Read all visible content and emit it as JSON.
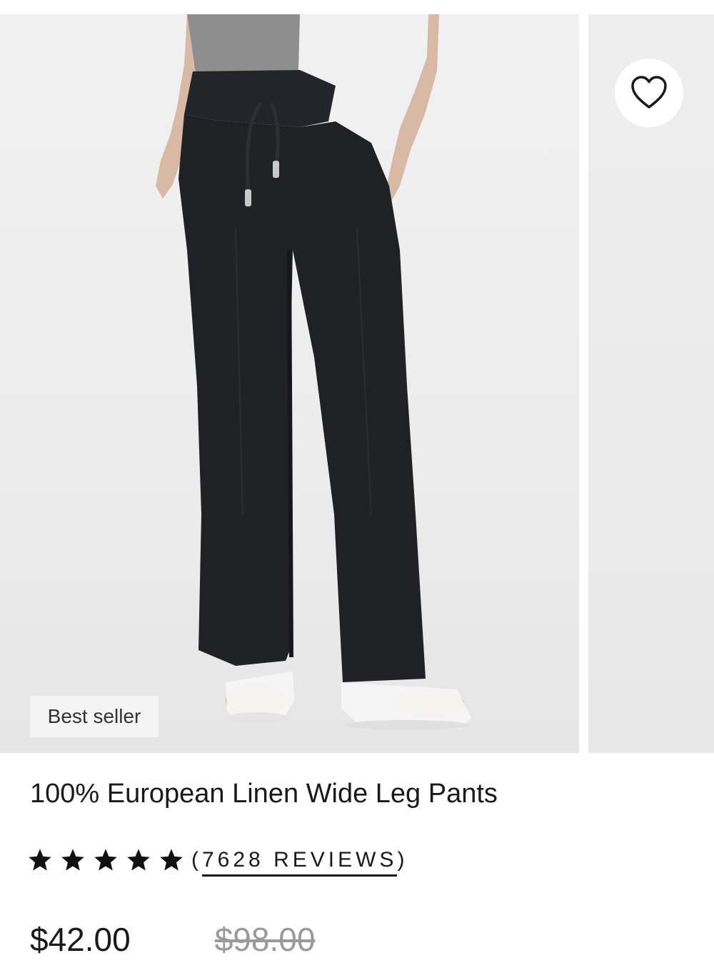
{
  "gallery": {
    "badge": "Best seller",
    "wishlist_icon": "heart-outline-icon"
  },
  "product": {
    "title": "100% European Linen Wide Leg Pants",
    "rating": {
      "stars": 5,
      "star_icon": "star-filled-icon",
      "reviews_open": "(",
      "reviews_text": "7628 REVIEWS",
      "reviews_close": ")"
    },
    "price": {
      "current": "$42.00",
      "original": "$98.00"
    }
  },
  "colors": {
    "text": "#1a1a1a",
    "muted_price": "#9a9a9a",
    "pants": "#1f2125",
    "image_bg": "#ececec"
  }
}
